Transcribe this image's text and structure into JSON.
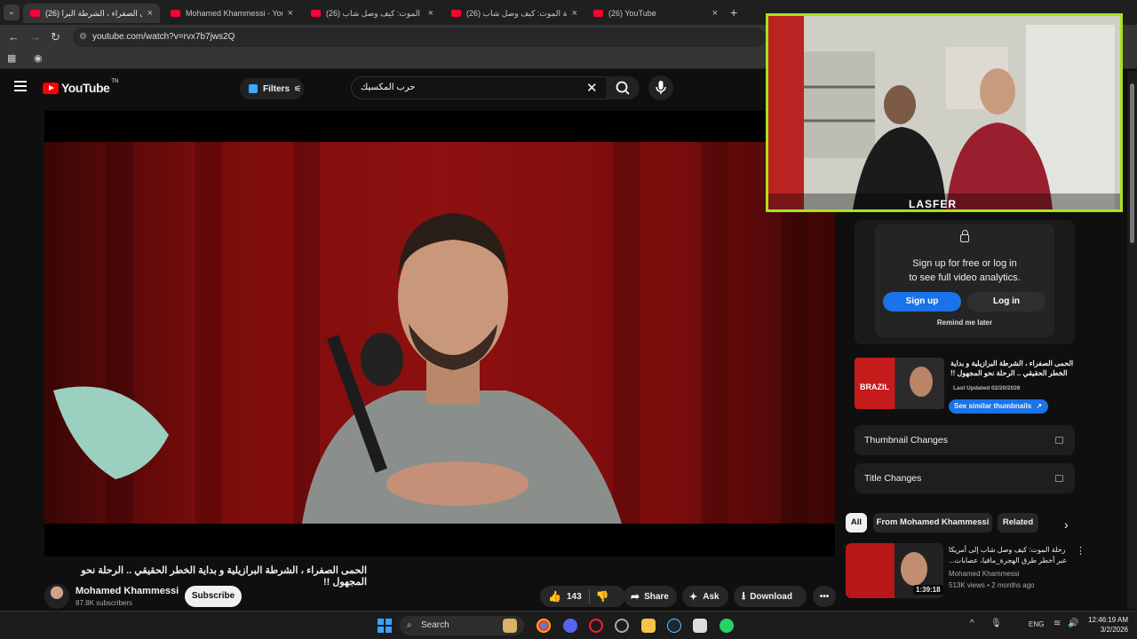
{
  "browser": {
    "tabs": [
      {
        "label": "(26) الحمى الصفراء ، الشرطة البرا",
        "active": true
      },
      {
        "label": "Mohamed Khammessi - YouTub",
        "active": false
      },
      {
        "label": "(26) رحلة الموت: كيف وصل شاب",
        "active": false
      },
      {
        "label": "(26) رحلة الموت: كيف وصل شاب",
        "active": false
      },
      {
        "label": "(26) YouTube",
        "active": false
      }
    ],
    "url": "youtube.com/watch?v=rvx7b7jws2Q"
  },
  "youtube": {
    "logo_text": "YouTube",
    "logo_superscript": "TN",
    "filters_label": "Filters",
    "search_query": "حرب المكسيك"
  },
  "video": {
    "title": "الحمى الصفراء ، الشرطة البرازيلية و بداية الخطر الحقيقي .. الرحلة نحو المجهول !!",
    "channel": "Mohamed Khammessi",
    "subscribers": "87.8K subscribers",
    "subscribe_label": "Subscribe",
    "likes": "143",
    "share_label": "Share",
    "ask_label": "Ask",
    "download_label": "Download"
  },
  "webcam_overlay": {
    "brand_text": "LASFER"
  },
  "analytics": {
    "signup_line1": "Sign up for free or log in",
    "signup_line2": "to see full video analytics.",
    "signup_button": "Sign up",
    "login_button": "Log in",
    "remind_label": "Remind me later",
    "thumb_title": "الحمى الصفراء ، الشرطة البرازيلية و بداية الخطر الحقيقي .. الرحلة نحو المجهول !!",
    "thumb_label": "BRAZIL",
    "last_updated": "Last Updated 02/20/2026",
    "similar_button": "See similar thumbnails",
    "thumbnail_changes": "Thumbnail Changes",
    "title_changes": "Title Changes"
  },
  "filter_chips": [
    "All",
    "From Mohamed Khammessi",
    "Related"
  ],
  "recommendations": [
    {
      "title": "رحلة الموت: كيف وصل شاب إلى أمريكا عبر أخطر طرق الهجرة_مافيا، عصابات...",
      "channel": "Mohamed Khammessi",
      "meta": "513K views • 2 months ago",
      "duration": "1:39:18"
    }
  ],
  "taskbar": {
    "search_label": "Search",
    "language": "ENG",
    "time": "12:46:19 AM",
    "date": "3/2/2026"
  },
  "colors": {
    "accent_blue": "#1a73e8",
    "youtube_red": "#ff0000",
    "webcam_border": "#a9e31d"
  }
}
